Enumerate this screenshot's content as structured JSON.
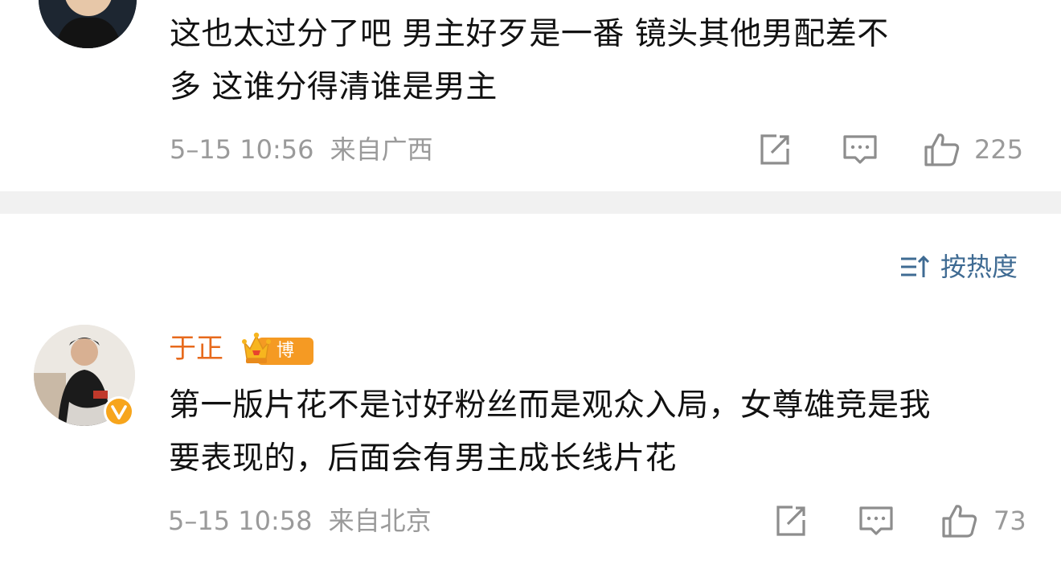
{
  "comments": [
    {
      "text": "这也太过分了吧 男主好歹是一番 镜头其他男配差不\n多 这谁分得清谁是男主",
      "timestamp": "5–15 10:56",
      "location": "来自广西",
      "like_count": "225"
    },
    {
      "username": "于正",
      "badge": "博主",
      "text": "第一版片花不是讨好粉丝而是观众入局，女尊雄竞是我\n要表现的，后面会有男主成长线片花",
      "timestamp": "5–15 10:58",
      "location": "来自北京",
      "like_count": "73"
    }
  ],
  "sort": {
    "label": "按热度"
  },
  "icons": {
    "share": "share-icon",
    "comment": "comment-icon",
    "like": "thumbs-up-icon",
    "sort": "sort-icon",
    "verified": "verified-v-icon",
    "crown": "crown-icon"
  },
  "colors": {
    "username": "#e76a1c",
    "badge": "#f59a23",
    "sort": "#3f6b93",
    "meta": "#9a9a9a",
    "divider": "#f1f1f1"
  }
}
